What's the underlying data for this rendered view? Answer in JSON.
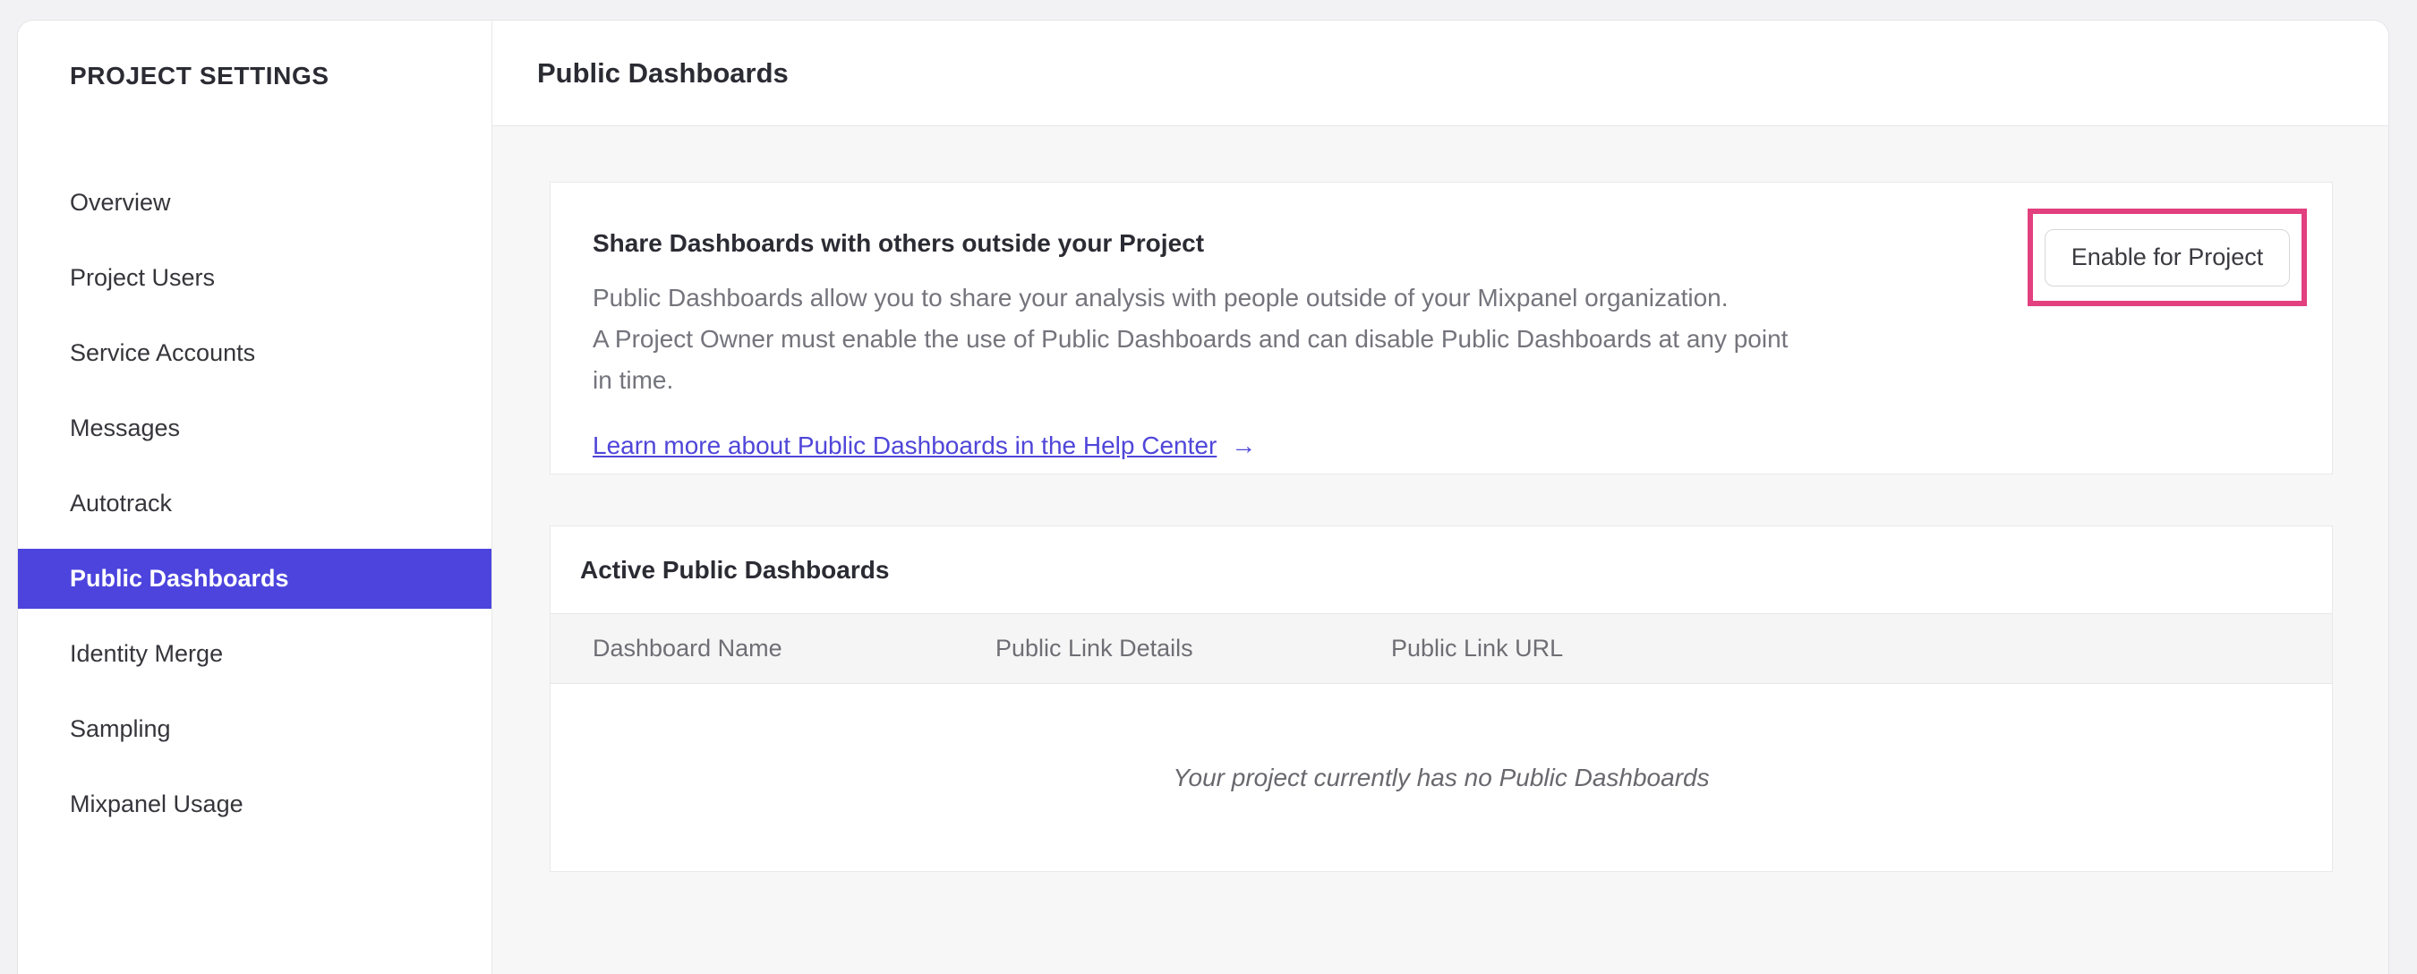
{
  "sidebar": {
    "title": "PROJECT SETTINGS",
    "items": [
      {
        "label": "Overview",
        "selected": false
      },
      {
        "label": "Project Users",
        "selected": false
      },
      {
        "label": "Service Accounts",
        "selected": false
      },
      {
        "label": "Messages",
        "selected": false
      },
      {
        "label": "Autotrack",
        "selected": false
      },
      {
        "label": "Public Dashboards",
        "selected": true
      },
      {
        "label": "Identity Merge",
        "selected": false
      },
      {
        "label": "Sampling",
        "selected": false
      },
      {
        "label": "Mixpanel Usage",
        "selected": false
      }
    ]
  },
  "header": {
    "title": "Public Dashboards"
  },
  "share_card": {
    "title": "Share Dashboards with others outside your Project",
    "description_lines": [
      "Public Dashboards allow you to share your analysis with people outside of your Mixpanel organization.",
      "A Project Owner must enable the use of Public Dashboards and can disable Public Dashboards at any point",
      "in time."
    ],
    "link_label": "Learn more about Public Dashboards in the Help Center",
    "link_arrow": "→",
    "enable_button_label": "Enable for Project"
  },
  "active_card": {
    "title": "Active Public Dashboards",
    "columns": [
      "Dashboard Name",
      "Public Link Details",
      "Public Link URL"
    ],
    "empty_message": "Your project currently has no Public Dashboards"
  },
  "colors": {
    "accent_purple": "#4c44dd",
    "link_purple": "#4f46d9",
    "annotation_pink": "#e2407f"
  }
}
